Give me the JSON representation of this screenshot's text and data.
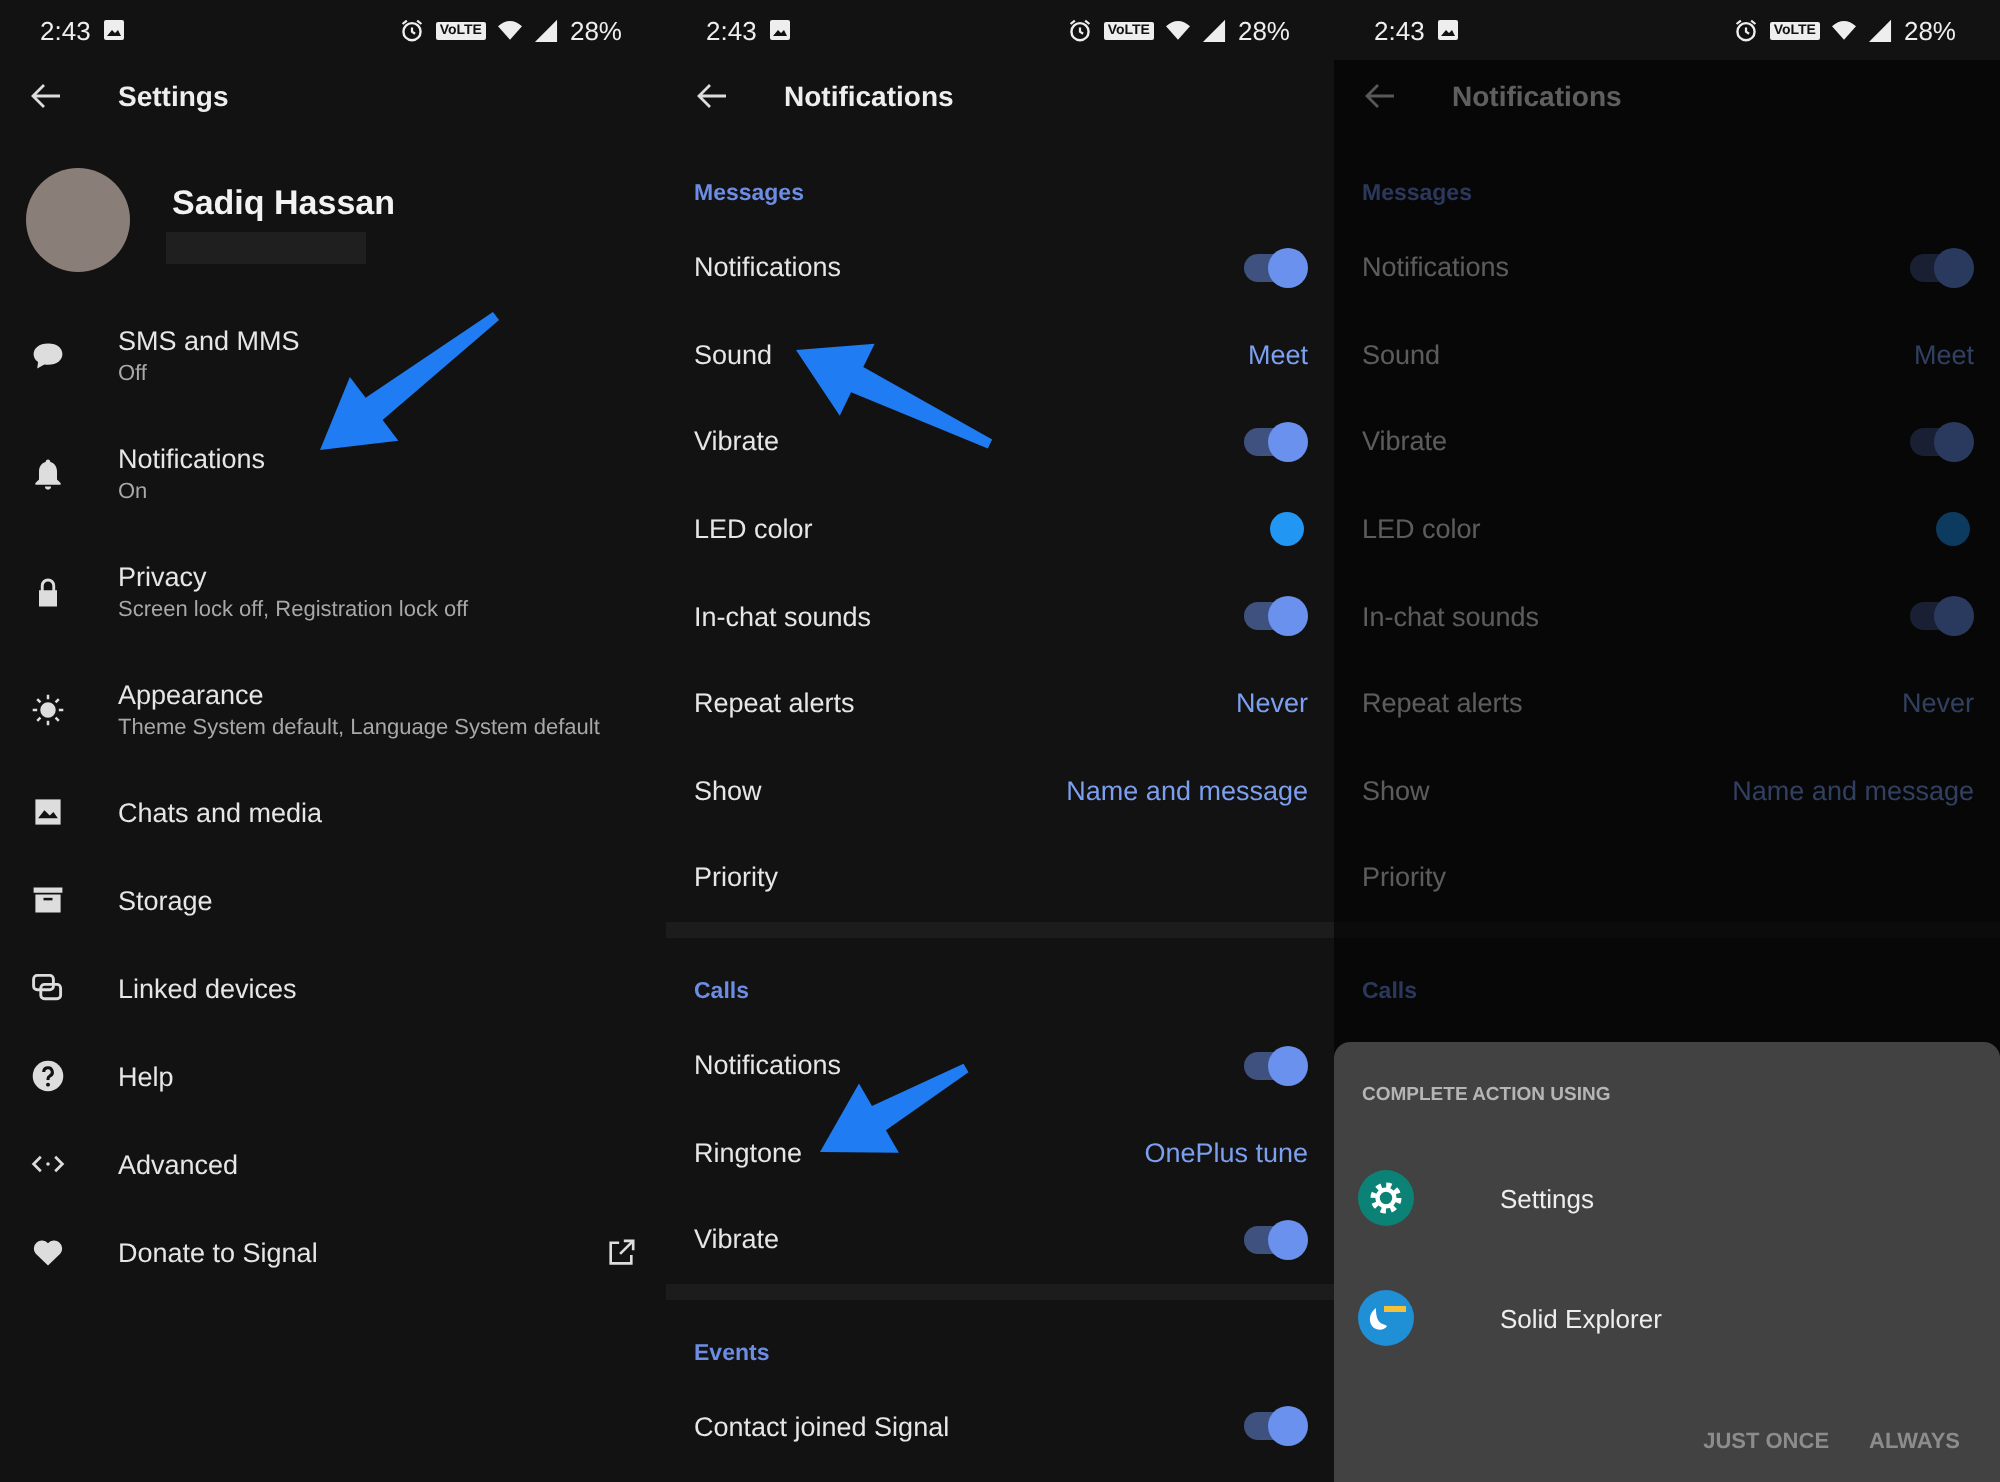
{
  "panels": [
    {
      "kind": "settings",
      "status_bar": {
        "time": "2:43",
        "network": "VoLTE",
        "battery": "28%"
      },
      "title": "Settings",
      "profile": {
        "name": "Sadiq Hassan"
      },
      "items": [
        {
          "label": "SMS and MMS",
          "sublabel": "Off"
        },
        {
          "label": "Notifications",
          "sublabel": "On"
        },
        {
          "label": "Privacy",
          "sublabel": "Screen lock off, Registration lock off"
        },
        {
          "label": "Appearance",
          "sublabel": "Theme System default, Language System default"
        },
        {
          "label": "Chats and media"
        },
        {
          "label": "Storage"
        },
        {
          "label": "Linked devices"
        },
        {
          "label": "Help"
        },
        {
          "label": "Advanced"
        },
        {
          "label": "Donate to Signal",
          "external": true
        }
      ]
    },
    {
      "kind": "notifications",
      "status_bar": {
        "time": "2:43",
        "network": "VoLTE",
        "battery": "28%"
      },
      "title": "Notifications",
      "sections": [
        {
          "title": "Messages",
          "rows": [
            {
              "kind": "toggle",
              "label": "Notifications",
              "on": true
            },
            {
              "kind": "value",
              "label": "Sound",
              "value": "Meet"
            },
            {
              "kind": "toggle",
              "label": "Vibrate",
              "on": true
            },
            {
              "kind": "color",
              "label": "LED color",
              "color": "#2196f3"
            },
            {
              "kind": "toggle",
              "label": "In-chat sounds",
              "on": true
            },
            {
              "kind": "value",
              "label": "Repeat alerts",
              "value": "Never"
            },
            {
              "kind": "value",
              "label": "Show",
              "value": "Name and message"
            },
            {
              "kind": "plain",
              "label": "Priority"
            }
          ]
        },
        {
          "title": "Calls",
          "rows": [
            {
              "kind": "toggle",
              "label": "Notifications",
              "on": true
            },
            {
              "kind": "value",
              "label": "Ringtone",
              "value": "OnePlus tune"
            },
            {
              "kind": "toggle",
              "label": "Vibrate",
              "on": true
            }
          ]
        },
        {
          "title": "Events",
          "rows": [
            {
              "kind": "toggle",
              "label": "Contact joined Signal",
              "on": true
            }
          ]
        }
      ]
    },
    {
      "kind": "notifications",
      "status_bar": {
        "time": "2:43",
        "network": "VoLTE",
        "battery": "28%"
      },
      "title": "Notifications",
      "dimmed": true,
      "sections": [
        {
          "title": "Messages",
          "rows": [
            {
              "kind": "toggle",
              "label": "Notifications",
              "on": true
            },
            {
              "kind": "value",
              "label": "Sound",
              "value": "Meet"
            },
            {
              "kind": "toggle",
              "label": "Vibrate",
              "on": true
            },
            {
              "kind": "color",
              "label": "LED color",
              "color": "#0c3b5f"
            },
            {
              "kind": "toggle",
              "label": "In-chat sounds",
              "on": true
            },
            {
              "kind": "value",
              "label": "Repeat alerts",
              "value": "Never"
            },
            {
              "kind": "value",
              "label": "Show",
              "value": "Name and message"
            },
            {
              "kind": "plain",
              "label": "Priority"
            }
          ]
        },
        {
          "title": "Calls"
        }
      ],
      "dialog": {
        "title": "COMPLETE ACTION USING",
        "apps": [
          {
            "name": "Settings"
          },
          {
            "name": "Solid Explorer"
          }
        ],
        "buttons": [
          {
            "label": "JUST ONCE",
            "disabled": true
          },
          {
            "label": "ALWAYS",
            "disabled": true
          }
        ]
      }
    }
  ]
}
